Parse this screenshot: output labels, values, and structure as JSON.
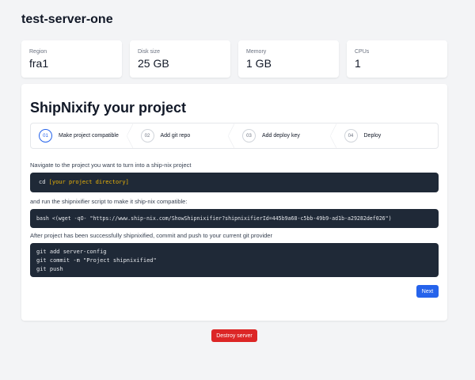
{
  "server_title": "test-server-one",
  "stats": [
    {
      "label": "Region",
      "value": "fra1"
    },
    {
      "label": "Disk size",
      "value": "25 GB"
    },
    {
      "label": "Memory",
      "value": "1 GB"
    },
    {
      "label": "CPUs",
      "value": "1"
    }
  ],
  "wizard": {
    "heading": "ShipNixify your project",
    "steps": [
      {
        "num": "01",
        "label": "Make project compatible",
        "active": true
      },
      {
        "num": "02",
        "label": "Add git repo"
      },
      {
        "num": "03",
        "label": "Add deploy key"
      },
      {
        "num": "04",
        "label": "Deploy"
      }
    ],
    "instruction1": "Navigate to the project you want to turn into a ship-nix project",
    "code1_cmd": "cd ",
    "code1_arg": "[your project directory]",
    "instruction2": "and run the shipnixifier script to make it ship-nix compatible:",
    "code2": "bash <(wget -qO- \"https://www.ship-nix.com/ShowShipnixifier?shipnixifierId=445b9a68-c5bb-49b9-ad1b-a29282def026\")",
    "instruction3": "After project has been successfully shipnixified, commit and push to your current git provider",
    "code3": [
      "git add server-config",
      "git commit -m \"Project shipnixified\"",
      "git push"
    ],
    "next_label": "Next"
  },
  "destroy_label": "Destroy server",
  "colors": {
    "primary": "#2563eb",
    "danger": "#dc2626",
    "code_bg": "#1f2937"
  }
}
